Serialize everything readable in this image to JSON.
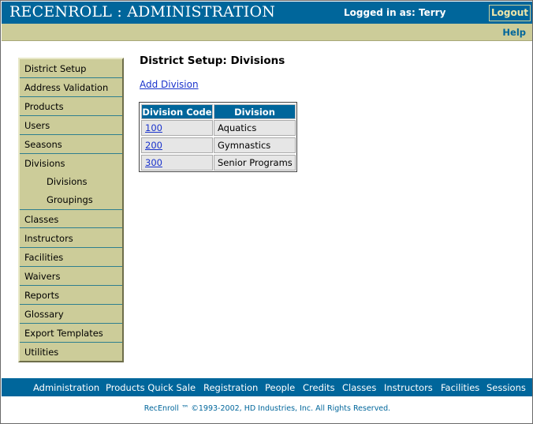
{
  "header": {
    "app_title": "RECENROLL : ADMINISTRATION",
    "logged_in": "Logged in as: Terry",
    "logout_label": "Logout"
  },
  "subbar": {
    "help_label": "Help"
  },
  "sidebar": {
    "items": [
      {
        "label": "District Setup"
      },
      {
        "label": "Address Validation"
      },
      {
        "label": "Products"
      },
      {
        "label": "Users"
      },
      {
        "label": "Seasons"
      },
      {
        "label": "Divisions"
      },
      {
        "label": "Divisions"
      },
      {
        "label": "Groupings"
      },
      {
        "label": "Classes"
      },
      {
        "label": "Instructors"
      },
      {
        "label": "Facilities"
      },
      {
        "label": "Waivers"
      },
      {
        "label": "Reports"
      },
      {
        "label": "Glossary"
      },
      {
        "label": "Export Templates"
      },
      {
        "label": "Utilities"
      }
    ]
  },
  "main": {
    "title": "District Setup: Divisions",
    "add_link": "Add Division",
    "table": {
      "headers": [
        "Division Code",
        "Division"
      ],
      "rows": [
        {
          "code": "100",
          "name": "Aquatics"
        },
        {
          "code": "200",
          "name": "Gymnastics"
        },
        {
          "code": "300",
          "name": "Senior Programs"
        }
      ]
    }
  },
  "footer": {
    "nav": [
      {
        "label": "Administration"
      },
      {
        "label": "Products Quick Sale"
      },
      {
        "label": "Registration"
      },
      {
        "label": "People"
      },
      {
        "label": "Credits"
      },
      {
        "label": "Classes"
      },
      {
        "label": "Instructors"
      },
      {
        "label": "Facilities"
      },
      {
        "label": "Sessions"
      }
    ],
    "copyright": "RecEnroll ™ ©1993-2002,  HD Industries, Inc.  All Rights Reserved."
  },
  "colors": {
    "brand_blue": "#00669b",
    "khaki": "#cccc99",
    "link": "#1a33cc"
  }
}
